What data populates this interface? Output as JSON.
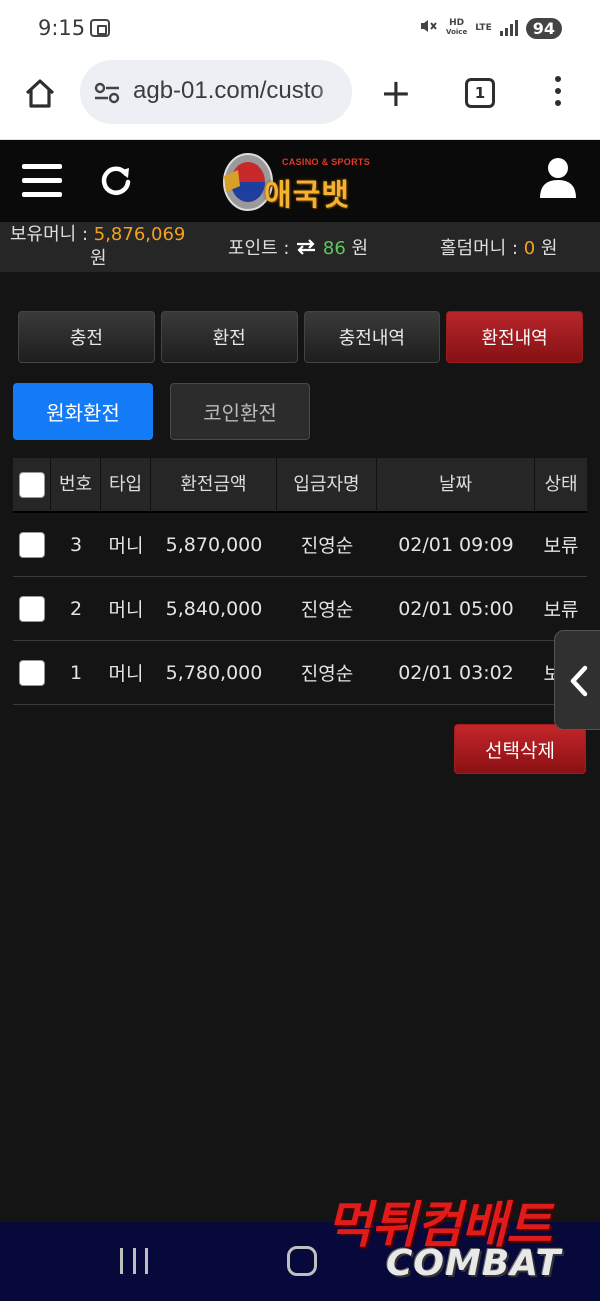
{
  "status_bar": {
    "time": "9:15",
    "battery": "94",
    "hd_label": "HD",
    "voice_label": "Voice",
    "lte_label": "LTE"
  },
  "browser": {
    "url": "agb-01.com/custo",
    "tab_count": "1"
  },
  "site": {
    "logo_sub": "CASINO & SPORTS",
    "logo_main": "애국뱃"
  },
  "money": {
    "hold_label": "보유머니 : ",
    "hold_value": "5,876,069",
    "hold_unit": "원",
    "point_label": "포인트 : ",
    "point_value": "86",
    "point_unit": " 원",
    "holdem_label": "홀덤머니 : ",
    "holdem_value": "0",
    "holdem_unit": " 원"
  },
  "tabs": [
    {
      "label": "충전",
      "active": false
    },
    {
      "label": "환전",
      "active": false
    },
    {
      "label": "충전내역",
      "active": false
    },
    {
      "label": "환전내역",
      "active": true
    }
  ],
  "sub_tabs": {
    "won": "원화환전",
    "coin": "코인환전"
  },
  "table": {
    "headers": [
      "번호",
      "타입",
      "환전금액",
      "입금자명",
      "날짜",
      "상태"
    ],
    "rows": [
      {
        "no": "3",
        "type": "머니",
        "amount": "5,870,000",
        "name": "진영순",
        "date": "02/01 09:09",
        "status": "보류"
      },
      {
        "no": "2",
        "type": "머니",
        "amount": "5,840,000",
        "name": "진영순",
        "date": "02/01 05:00",
        "status": "보류"
      },
      {
        "no": "1",
        "type": "머니",
        "amount": "5,780,000",
        "name": "진영순",
        "date": "02/01 03:02",
        "status": "보류"
      }
    ]
  },
  "delete_label": "선택삭제",
  "watermark": {
    "korean": "먹튀컴배트",
    "english": "COMBAT"
  }
}
